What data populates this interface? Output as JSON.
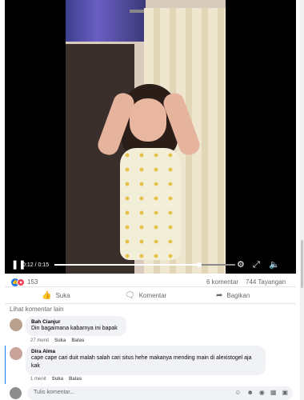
{
  "video": {
    "time_display": "0:12 / 0:15",
    "progress": 0.8,
    "icons": [
      "play-pause-icon",
      "settings-icon",
      "fullscreen-icon",
      "volume-icon"
    ]
  },
  "stats": {
    "reaction_count": "153",
    "comments": "6 komentar",
    "views": "744 Tayangan"
  },
  "actions": {
    "like": "Suka",
    "comment": "Komentar",
    "share": "Bagikan"
  },
  "more_comments": "Lihat komentar lain",
  "comments": [
    {
      "name": "Bah Cianjur",
      "text": "Din bagaimana kabarnya ini bapak",
      "time": "27 menit",
      "like": "Suka",
      "reply": "Balas"
    },
    {
      "name": "Dira Alma",
      "text": "cape cape cari duit malah salah cari situs hehe makanya mending main di alexistogel aja kak",
      "time": "1 menit",
      "like": "Suka",
      "reply": "Balas"
    }
  ],
  "composer": {
    "placeholder": "Tulis komentar..."
  },
  "colors": {
    "accent": "#1877f2",
    "love": "#f33e58",
    "muted_text": "#65676b",
    "bubble": "#f0f2f5"
  }
}
